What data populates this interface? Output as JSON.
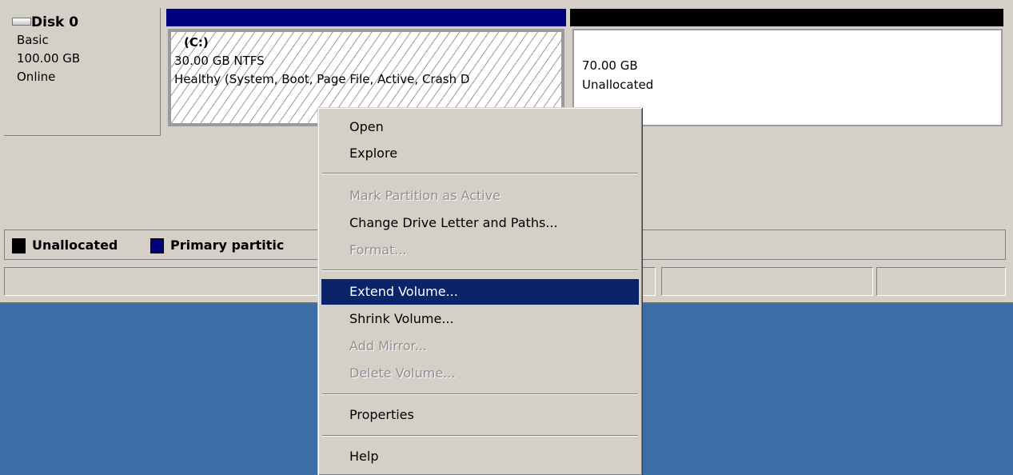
{
  "disk": {
    "name": "Disk 0",
    "type": "Basic",
    "size": "100.00 GB",
    "status": "Online"
  },
  "colors": {
    "primary_partition": "#000080",
    "unallocated": "#000000",
    "menu_selection": "#0a246a",
    "desktop": "#3a6ea5"
  },
  "volumes": [
    {
      "label": "(C:)",
      "size_fs": "30.00 GB NTFS",
      "status": "Healthy (System, Boot, Page File, Active, Crash D"
    },
    {
      "size": "70.00 GB",
      "status": "Unallocated"
    }
  ],
  "legend": {
    "items": [
      {
        "label": "Unallocated",
        "color": "#000000"
      },
      {
        "label": "Primary partitic",
        "color": "#000080"
      }
    ]
  },
  "context_menu": {
    "items": [
      {
        "label": "Open",
        "disabled": false
      },
      {
        "label": "Explore",
        "disabled": false
      },
      {
        "label": "Mark Partition as Active",
        "disabled": true
      },
      {
        "label": "Change Drive Letter and Paths...",
        "disabled": false
      },
      {
        "label": "Format...",
        "disabled": true
      },
      {
        "label": "Extend Volume...",
        "disabled": false,
        "selected": true
      },
      {
        "label": "Shrink Volume...",
        "disabled": false
      },
      {
        "label": "Add Mirror...",
        "disabled": true
      },
      {
        "label": "Delete Volume...",
        "disabled": true
      },
      {
        "label": "Properties",
        "disabled": false
      },
      {
        "label": "Help",
        "disabled": false
      }
    ]
  }
}
